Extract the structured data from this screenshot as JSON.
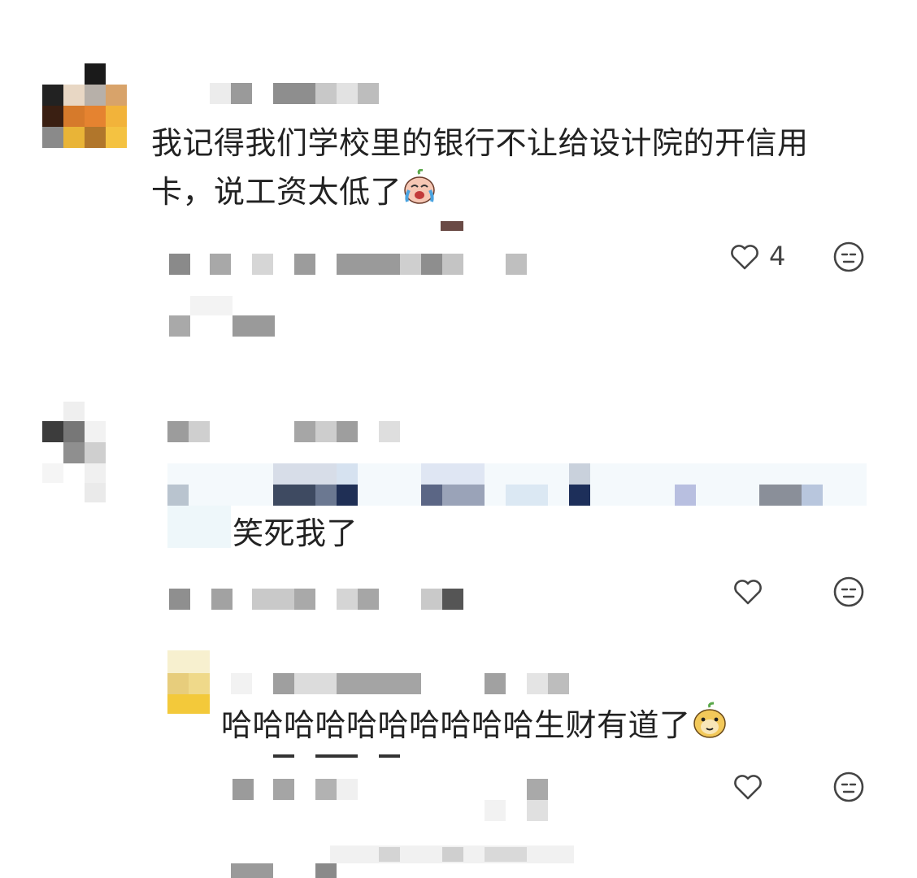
{
  "comments": [
    {
      "text": "我记得我们学校里的银行不让给设计院的开信用卡，说工资太低了",
      "emoji": "crying-laughing-sticker",
      "like_count": "4",
      "liked": false
    },
    {
      "text": "笑死我了",
      "like_count": "",
      "liked": false
    },
    {
      "text": "哈哈哈哈哈哈哈哈哈哈生财有道了",
      "emoji": "smug-sticker",
      "like_count": "",
      "liked": false,
      "is_reply": true
    }
  ],
  "icons": {
    "like": "heart-outline-icon",
    "dislike": "meh-face-icon"
  }
}
